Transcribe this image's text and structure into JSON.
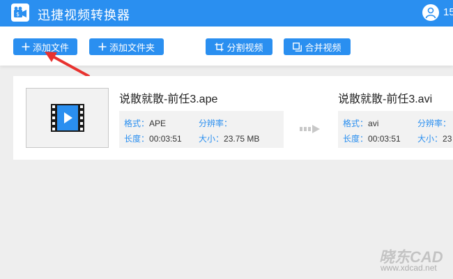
{
  "app": {
    "title": "迅捷视频转换器",
    "user_id": "15",
    "accent_color": "#2a8ff0"
  },
  "toolbar": {
    "add_file_label": "添加文件",
    "add_folder_label": "添加文件夹",
    "split_label": "分割视频",
    "merge_label": "合并视频"
  },
  "file": {
    "source": {
      "name": "说散就散-前任3.ape",
      "format_key": "格式：",
      "format": "APE",
      "resolution_key": "分辨率：",
      "resolution": "",
      "duration_key": "长度：",
      "duration": "00:03:51",
      "size_key": "大小：",
      "size": "23.75 MB"
    },
    "target": {
      "name": "说散就散-前任3.avi",
      "format_key": "格式：",
      "format": "avi",
      "resolution_key": "分辨率：",
      "resolution": "",
      "duration_key": "长度：",
      "duration": "00:03:51",
      "size_key": "大小：",
      "size": "23"
    }
  },
  "watermark": {
    "logo_text": "晓东CAD",
    "url": "www.xdcad.net"
  },
  "icons": {
    "logo": "video-camera-icon",
    "user": "user-avatar-icon",
    "add": "plus-icon",
    "split": "crop-icon",
    "merge": "merge-icon",
    "annotation": "red-arrow-icon",
    "thumb": "video-file-icon",
    "convert": "convert-arrow-icon"
  }
}
